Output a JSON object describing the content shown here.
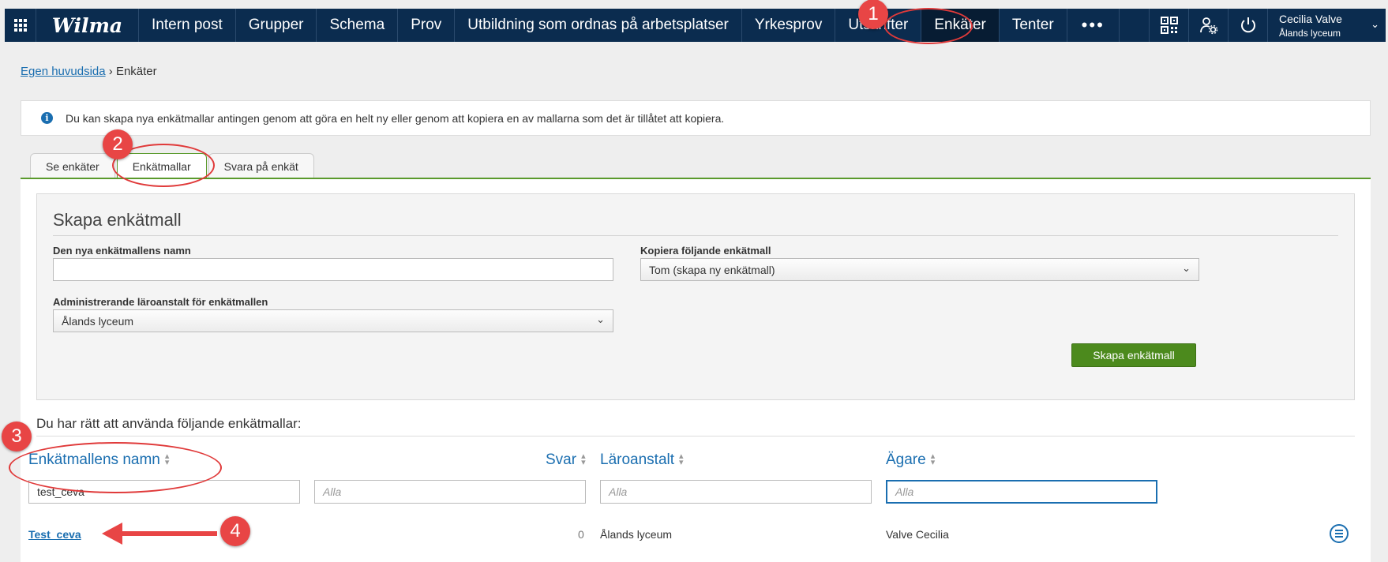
{
  "nav": {
    "logo": "Wilma",
    "items": [
      "Intern post",
      "Grupper",
      "Schema",
      "Prov",
      "Utbildning som ordnas på arbetsplatser",
      "Yrkesprov",
      "Utskrifter",
      "Enkäter",
      "Tenter"
    ],
    "more": "•••",
    "user_name": "Cecilia Valve",
    "user_school": "Ålands lyceum"
  },
  "breadcrumb": {
    "home": "Egen huvudsida",
    "separator": "›",
    "current": "Enkäter"
  },
  "info": {
    "icon": "i",
    "text": "Du kan skapa nya enkätmallar antingen genom att göra en helt ny eller genom att kopiera en av mallarna som det är tillåtet att kopiera."
  },
  "tabs": [
    "Se enkäter",
    "Enkätmallar",
    "Svara på enkät"
  ],
  "form": {
    "title": "Skapa enkätmall",
    "name_label": "Den nya enkätmallens namn",
    "name_value": "",
    "copy_label": "Kopiera följande enkätmall",
    "copy_value": "Tom (skapa ny enkätmall)",
    "school_label": "Administrerande läroanstalt för enkätmallen",
    "school_value": "Ålands lyceum",
    "create_button": "Skapa enkätmall"
  },
  "list": {
    "heading": "Du har rätt att använda följande enkätmallar:",
    "columns": [
      "Enkätmallens namn",
      "Svar",
      "Läroanstalt",
      "Ägare"
    ],
    "filters": {
      "name": "test_ceva",
      "svar": "Alla",
      "school": "Alla",
      "owner": "Alla"
    },
    "rows": [
      {
        "name": "Test_ceva",
        "svar": "0",
        "school": "Ålands lyceum",
        "owner": "Valve Cecilia"
      }
    ]
  },
  "annotations": [
    "1",
    "2",
    "3",
    "4"
  ],
  "colors": {
    "nav_bg": "#0b2c4f",
    "accent_blue": "#1a6eb0",
    "green": "#4c8a1d",
    "annotation_red": "#e84545"
  }
}
